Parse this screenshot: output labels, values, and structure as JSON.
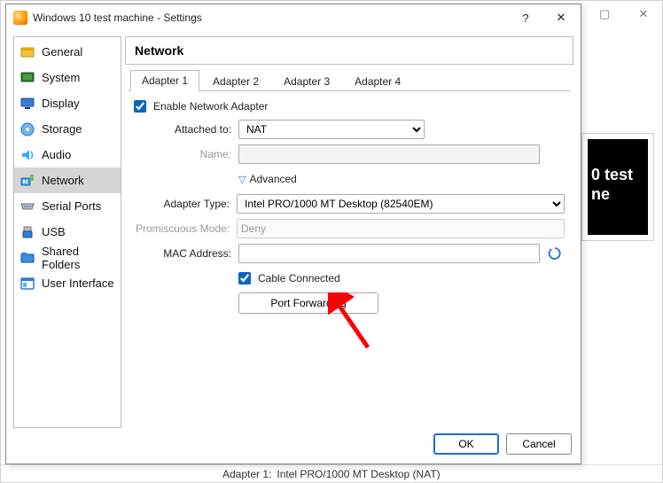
{
  "bg_window": {
    "btn_min": "—",
    "btn_max": "▢",
    "btn_close": "✕",
    "preview_line1": "0 test",
    "preview_line2": "ne",
    "status_label": "Adapter 1:",
    "status_value": "Intel PRO/1000 MT Desktop (NAT)"
  },
  "dialog": {
    "title": "Windows 10 test machine - Settings",
    "help": "?",
    "close": "✕",
    "ok": "OK",
    "cancel": "Cancel"
  },
  "sidebar": {
    "items": [
      {
        "label": "General",
        "icon": "general"
      },
      {
        "label": "System",
        "icon": "system"
      },
      {
        "label": "Display",
        "icon": "display"
      },
      {
        "label": "Storage",
        "icon": "storage"
      },
      {
        "label": "Audio",
        "icon": "audio"
      },
      {
        "label": "Network",
        "icon": "network",
        "selected": true
      },
      {
        "label": "Serial Ports",
        "icon": "serial"
      },
      {
        "label": "USB",
        "icon": "usb"
      },
      {
        "label": "Shared Folders",
        "icon": "shared"
      },
      {
        "label": "User Interface",
        "icon": "ui"
      }
    ]
  },
  "panel": {
    "title": "Network",
    "tabs": [
      "Adapter 1",
      "Adapter 2",
      "Adapter 3",
      "Adapter 4"
    ],
    "active_tab": 0,
    "enable_label": "Enable Network Adapter",
    "enable_checked": true,
    "attached_label": "Attached to:",
    "attached_value": "NAT",
    "name_label": "Name:",
    "name_value": "",
    "advanced_label": "Advanced",
    "advanced_expanded": true,
    "adapter_type_label": "Adapter Type:",
    "adapter_type_value": "Intel PRO/1000 MT Desktop (82540EM)",
    "promisc_label": "Promiscuous Mode:",
    "promisc_value": "Deny",
    "mac_label": "MAC Address:",
    "mac_value": "",
    "cable_label": "Cable Connected",
    "cable_checked": true,
    "port_forwarding": "Port Forwarding"
  }
}
